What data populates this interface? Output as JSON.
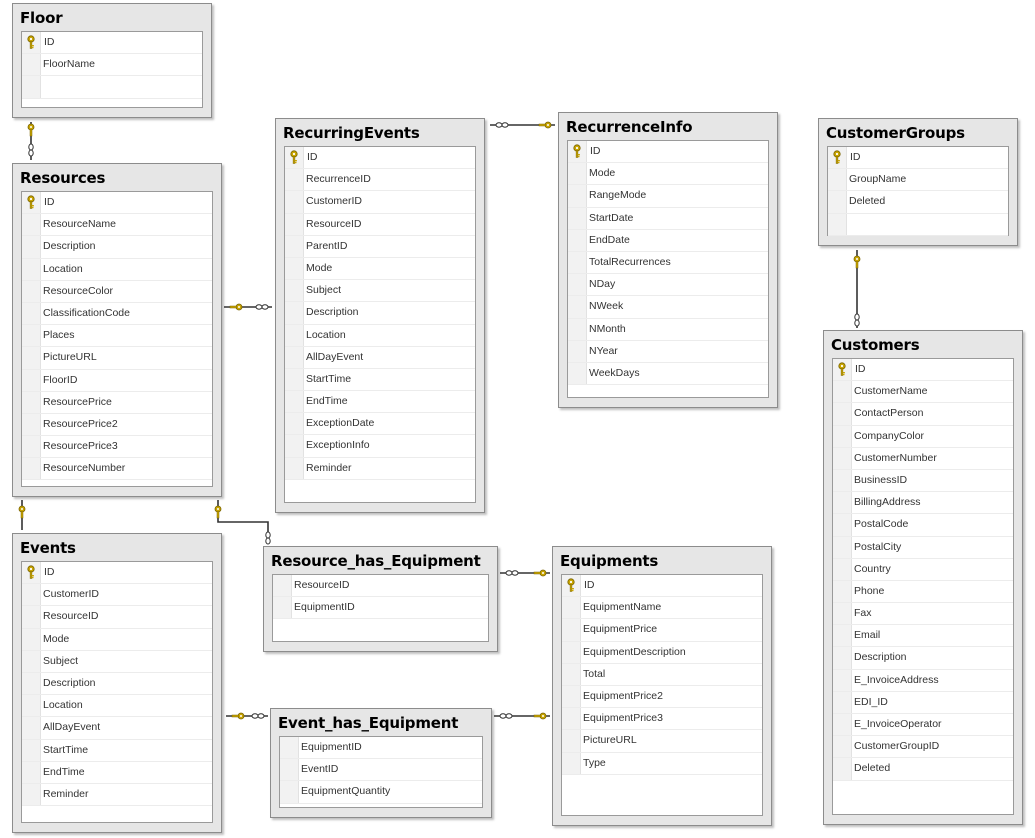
{
  "tables": {
    "floor": {
      "name": "Floor",
      "columns": [
        "ID",
        "FloorName"
      ]
    },
    "resources": {
      "name": "Resources",
      "columns": [
        "ID",
        "ResourceName",
        "Description",
        "Location",
        "ResourceColor",
        "ClassificationCode",
        "Places",
        "PictureURL",
        "FloorID",
        "ResourcePrice",
        "ResourcePrice2",
        "ResourcePrice3",
        "ResourceNumber"
      ]
    },
    "recurringevents": {
      "name": "RecurringEvents",
      "columns": [
        "ID",
        "RecurrenceID",
        "CustomerID",
        "ResourceID",
        "ParentID",
        "Mode",
        "Subject",
        "Description",
        "Location",
        "AllDayEvent",
        "StartTime",
        "EndTime",
        "ExceptionDate",
        "ExceptionInfo",
        "Reminder"
      ]
    },
    "recurrenceinfo": {
      "name": "RecurrenceInfo",
      "columns": [
        "ID",
        "Mode",
        "RangeMode",
        "StartDate",
        "EndDate",
        "TotalRecurrences",
        "NDay",
        "NWeek",
        "NMonth",
        "NYear",
        "WeekDays"
      ]
    },
    "customergroups": {
      "name": "CustomerGroups",
      "columns": [
        "ID",
        "GroupName",
        "Deleted"
      ]
    },
    "customers": {
      "name": "Customers",
      "columns": [
        "ID",
        "CustomerName",
        "ContactPerson",
        "CompanyColor",
        "CustomerNumber",
        "BusinessID",
        "BillingAddress",
        "PostalCode",
        "PostalCity",
        "Country",
        "Phone",
        "Fax",
        "Email",
        "Description",
        "E_InvoiceAddress",
        "EDI_ID",
        "E_InvoiceOperator",
        "CustomerGroupID",
        "Deleted"
      ]
    },
    "events": {
      "name": "Events",
      "columns": [
        "ID",
        "CustomerID",
        "ResourceID",
        "Mode",
        "Subject",
        "Description",
        "Location",
        "AllDayEvent",
        "StartTime",
        "EndTime",
        "Reminder"
      ]
    },
    "resource_has_equipment": {
      "name": "Resource_has_Equipment",
      "columns": [
        "ResourceID",
        "EquipmentID"
      ]
    },
    "event_has_equipment": {
      "name": "Event_has_Equipment",
      "columns": [
        "EquipmentID",
        "EventID",
        "EquipmentQuantity"
      ]
    },
    "equipments": {
      "name": "Equipments",
      "columns": [
        "ID",
        "EquipmentName",
        "EquipmentPrice",
        "EquipmentDescription",
        "Total",
        "EquipmentPrice2",
        "EquipmentPrice3",
        "PictureURL",
        "Type"
      ]
    }
  },
  "colors": {
    "key": "#c8a400",
    "line": "#333333",
    "panel": "#e6e6e6"
  },
  "icons": {
    "primary_key": "key-icon",
    "relationship_one": "key-icon",
    "relationship_many": "infinity-icon"
  }
}
